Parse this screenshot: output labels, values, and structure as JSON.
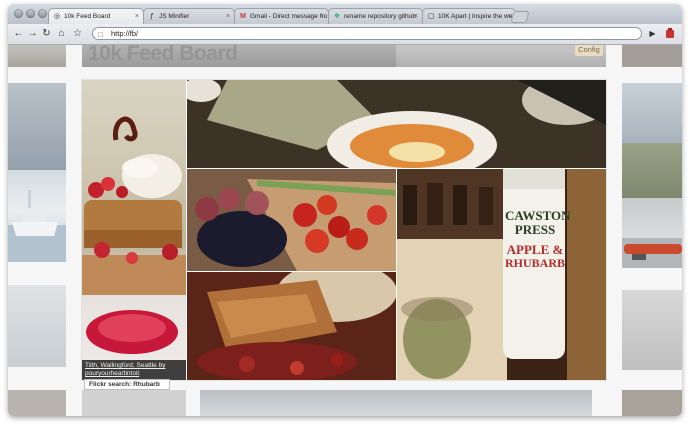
{
  "browser": {
    "tabs": [
      {
        "icon": "globe-icon",
        "label": "10k Feed Board",
        "glyph": "◎"
      },
      {
        "icon": "script-icon",
        "label": "JS Minifier",
        "glyph": "ƒ"
      },
      {
        "icon": "gmail-icon",
        "label": "Gmail - Direct message fro",
        "glyph": "M"
      },
      {
        "icon": "github-icon",
        "label": "rename repository github",
        "glyph": "❖"
      },
      {
        "icon": "page-icon",
        "label": "10K Apart | Inspire the we",
        "glyph": "▢"
      }
    ],
    "close_glyph": "×",
    "address": "http://fb/"
  },
  "app": {
    "title": "10k Feed Board",
    "config_label": "Config"
  },
  "lightbox": {
    "caption": "Tilth, Wallingford, Seattle by pouryourheartintoit",
    "search_label": "Flickr search: Rhubarb",
    "drink_label_1": "CAWSTON",
    "drink_label_2": "PRESS",
    "drink_label_3": "APPLE &",
    "drink_label_4": "RHUBARB"
  },
  "colors": {
    "accent_config_bg": "#e8dcc2",
    "titlebar": "#c9cfd7"
  }
}
